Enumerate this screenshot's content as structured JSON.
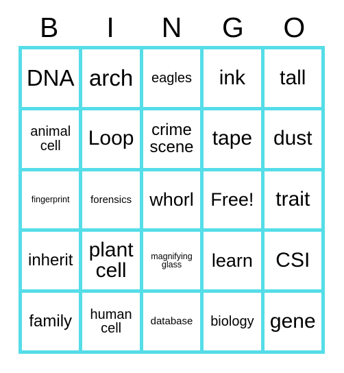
{
  "card": {
    "title": "BINGO Card",
    "border_color": "#55dde8",
    "background_color": "#ffffff",
    "text_color": "#000000"
  },
  "header": {
    "letters": [
      "B",
      "I",
      "N",
      "G",
      "O"
    ]
  },
  "grid": {
    "rows": 5,
    "columns": 5,
    "free_space": "Free!",
    "cells": [
      [
        {
          "text": "DNA",
          "size": "fs-xxl"
        },
        {
          "text": "arch",
          "size": "fs-xxl"
        },
        {
          "text": "eagles",
          "size": "fs-sm"
        },
        {
          "text": "ink",
          "size": "fs-xl"
        },
        {
          "text": "tall",
          "size": "fs-xl"
        }
      ],
      [
        {
          "text": "animal cell",
          "size": "fs-sm"
        },
        {
          "text": "Loop",
          "size": "fs-xl"
        },
        {
          "text": "crime scene",
          "size": "fs-md"
        },
        {
          "text": "tape",
          "size": "fs-xl"
        },
        {
          "text": "dust",
          "size": "fs-xl"
        }
      ],
      [
        {
          "text": "fingerprint",
          "size": "fs-xxs"
        },
        {
          "text": "forensics",
          "size": "fs-xs"
        },
        {
          "text": "whorl",
          "size": "fs-lg"
        },
        {
          "text": "Free!",
          "size": "fs-lg"
        },
        {
          "text": "trait",
          "size": "fs-xl"
        }
      ],
      [
        {
          "text": "inherit",
          "size": "fs-md"
        },
        {
          "text": "plant cell",
          "size": "fs-xl"
        },
        {
          "text": "magnifying glass",
          "size": "fs-xxs"
        },
        {
          "text": "learn",
          "size": "fs-lg"
        },
        {
          "text": "CSI",
          "size": "fs-xl"
        }
      ],
      [
        {
          "text": "family",
          "size": "fs-md"
        },
        {
          "text": "human cell",
          "size": "fs-sm"
        },
        {
          "text": "database",
          "size": "fs-xs"
        },
        {
          "text": "biology",
          "size": "fs-sm"
        },
        {
          "text": "gene",
          "size": "fs-xl"
        }
      ]
    ]
  }
}
